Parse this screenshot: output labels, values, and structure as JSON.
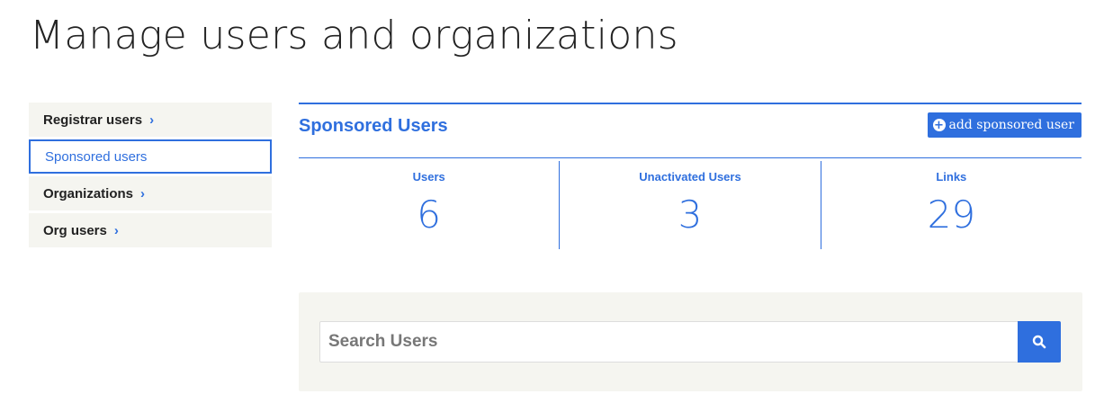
{
  "page": {
    "title": "Manage users and organizations"
  },
  "sidebar": {
    "items": [
      {
        "label": "Registrar users",
        "chevron": "›",
        "active": false
      },
      {
        "label": "Sponsored users",
        "chevron": "",
        "active": true
      },
      {
        "label": "Organizations",
        "chevron": "›",
        "active": false
      },
      {
        "label": "Org users",
        "chevron": "›",
        "active": false
      }
    ]
  },
  "main": {
    "section_title": "Sponsored Users",
    "add_button": {
      "icon": "plus-circle-icon",
      "label": "add sponsored user"
    },
    "stats": [
      {
        "label": "Users",
        "value": "6"
      },
      {
        "label": "Unactivated Users",
        "value": "3"
      },
      {
        "label": "Links",
        "value": "29"
      }
    ]
  },
  "search": {
    "placeholder": "Search Users",
    "value": "",
    "button_icon": "search-icon"
  },
  "colors": {
    "accent": "#2f6fde",
    "panel_bg": "#f5f5f0",
    "text": "#222222"
  }
}
